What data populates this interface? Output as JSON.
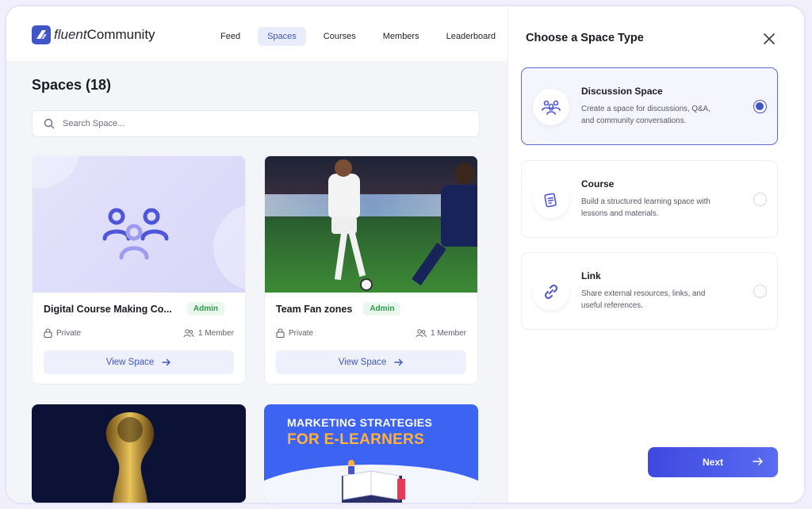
{
  "brand": {
    "name_light": "fluent",
    "name_bold": "Community"
  },
  "nav": [
    {
      "label": "Feed",
      "active": false
    },
    {
      "label": "Spaces",
      "active": true
    },
    {
      "label": "Courses",
      "active": false
    },
    {
      "label": "Members",
      "active": false
    },
    {
      "label": "Leaderboard",
      "active": false
    }
  ],
  "page": {
    "title": "Spaces (18)"
  },
  "search": {
    "placeholder": "Search Space..."
  },
  "cards": [
    {
      "title": "Digital Course Making Co...",
      "badge": "Admin",
      "privacy": "Private",
      "members": "1 Member",
      "action": "View Space"
    },
    {
      "title": "Team Fan zones",
      "badge": "Admin",
      "privacy": "Private",
      "members": "1 Member",
      "action": "View Space"
    },
    {
      "banner_line1": "MARKETING STRATEGIES",
      "banner_line2": "FOR E-LEARNERS"
    }
  ],
  "panel": {
    "title": "Choose a Space Type",
    "options": [
      {
        "title": "Discussion Space",
        "desc": "Create a space for discussions, Q&A, and community conversations.",
        "icon": "people-icon",
        "selected": true
      },
      {
        "title": "Course",
        "desc": "Build a structured learning space with lessons and materials.",
        "icon": "course-icon",
        "selected": false
      },
      {
        "title": "Link",
        "desc": "Share external resources, links, and useful references.",
        "icon": "link-icon",
        "selected": false
      }
    ],
    "next_label": "Next"
  },
  "colors": {
    "accent": "#3f55c8",
    "badge_green": "#2f9a4d",
    "next_gradient_start": "#3e49e0",
    "next_gradient_end": "#5a6cf0"
  }
}
